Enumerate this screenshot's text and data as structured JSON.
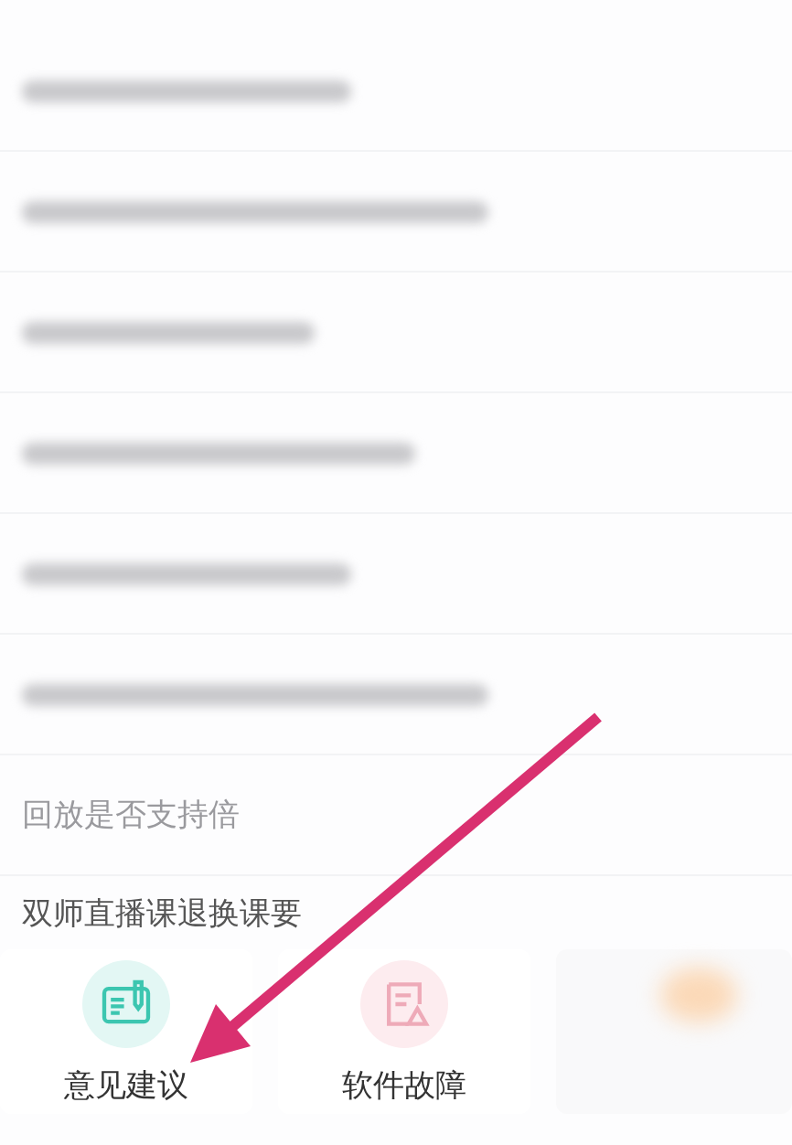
{
  "faq_list": [
    {
      "kind": "blurred"
    },
    {
      "kind": "blurred"
    },
    {
      "kind": "blurred"
    },
    {
      "kind": "blurred"
    },
    {
      "kind": "blurred"
    },
    {
      "kind": "blurred"
    },
    {
      "kind": "text",
      "text": "回放是否支持倍"
    },
    {
      "kind": "text",
      "text": "双师直播课退换课要"
    }
  ],
  "categories": [
    {
      "kind": "feedback",
      "label": "意见建议"
    },
    {
      "kind": "fault",
      "label": "软件故障"
    },
    {
      "kind": "blurred"
    }
  ],
  "annotation": {
    "kind": "arrow"
  }
}
